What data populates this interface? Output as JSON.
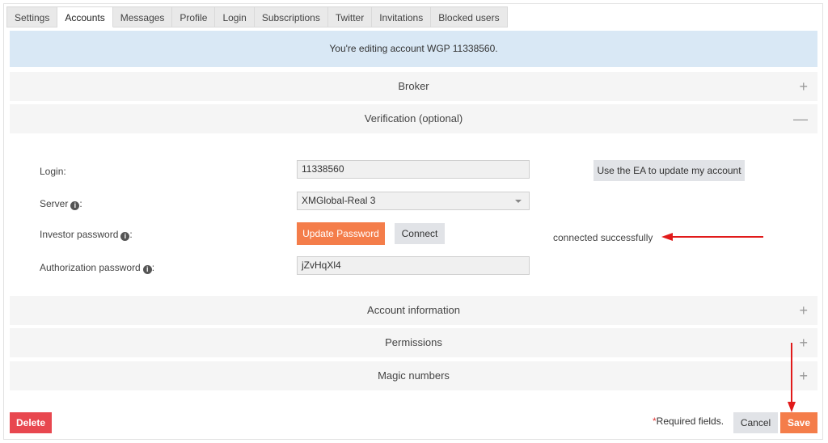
{
  "tabs": [
    {
      "label": "Settings"
    },
    {
      "label": "Accounts"
    },
    {
      "label": "Messages"
    },
    {
      "label": "Profile"
    },
    {
      "label": "Login"
    },
    {
      "label": "Subscriptions"
    },
    {
      "label": "Twitter"
    },
    {
      "label": "Invitations"
    },
    {
      "label": "Blocked users"
    }
  ],
  "active_tab": "Accounts",
  "notice": "You're editing account WGP 11338560.",
  "sections": {
    "broker": {
      "title": "Broker",
      "toggle": "+"
    },
    "verification": {
      "title": "Verification (optional)",
      "toggle": "—"
    },
    "account_info": {
      "title": "Account information",
      "toggle": "+"
    },
    "permissions": {
      "title": "Permissions",
      "toggle": "+"
    },
    "magic_numbers": {
      "title": "Magic numbers",
      "toggle": "+"
    }
  },
  "form": {
    "login_label": "Login:",
    "login_value": "11338560",
    "server_label": "Server",
    "server_suffix": ":",
    "server_value": "XMGlobal-Real 3",
    "investor_label": "Investor password",
    "investor_suffix": ":",
    "auth_label": "Authorization password",
    "auth_suffix": ":",
    "auth_value": "jZvHqXl4",
    "info_glyph": "i"
  },
  "buttons": {
    "use_ea": "Use the EA to update my account",
    "update_password": "Update Password",
    "connect": "Connect",
    "delete": "Delete",
    "cancel": "Cancel",
    "save": "Save"
  },
  "status": "connected successfully",
  "required_star": "*",
  "required_text": "Required fields.",
  "colors": {
    "accent_orange": "#f47d4a",
    "danger_red": "#e8474f",
    "notice_blue": "#d9e8f5",
    "annotation_arrow": "#e11a1a"
  }
}
